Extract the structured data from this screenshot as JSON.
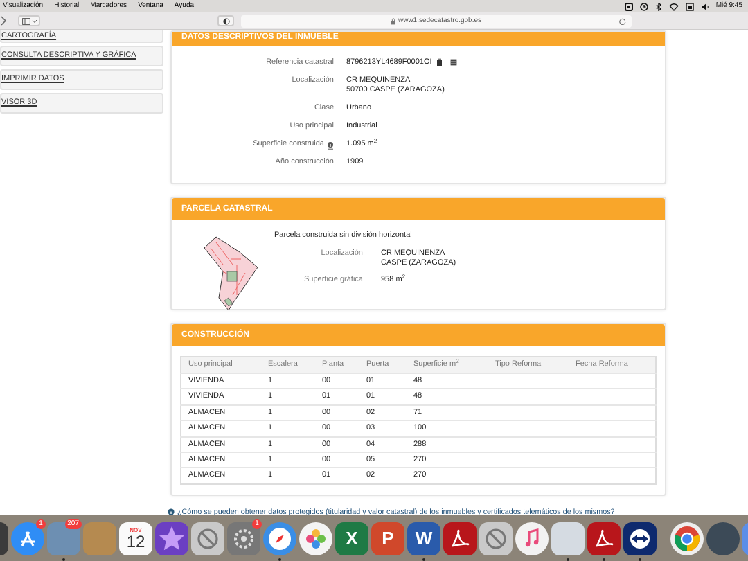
{
  "menu_bar": {
    "items": [
      "Visualización",
      "Historial",
      "Marcadores",
      "Ventana",
      "Ayuda"
    ],
    "clock": "Mié 9:45"
  },
  "toolbar": {
    "url": "www1.sedecatastro.gob.es"
  },
  "sidebar": {
    "items": [
      "CARTOGRAFÍA",
      "CONSULTA DESCRIPTIVA Y GRÁFICA",
      "IMPRIMIR DATOS",
      "VISOR 3D"
    ]
  },
  "sections": [
    {
      "kind": "fields",
      "title": "DATOS DESCRIPTIVOS DEL INMUEBLE",
      "fields": [
        {
          "label": "Referencia catastral",
          "value": [
            "8796213YL4689F0001OI"
          ],
          "tools": true
        },
        {
          "label": "Localización",
          "value": [
            "CR MEQUINENZA",
            "50700 CASPE (ZARAGOZA)"
          ]
        },
        {
          "label": "Clase",
          "value": [
            "Urbano"
          ]
        },
        {
          "label": "Uso principal",
          "value": [
            "Industrial"
          ]
        },
        {
          "label": "Superficie construida",
          "value": [
            "1.095 m$^{2}$"
          ],
          "info": true
        },
        {
          "label": "Año construcción",
          "value": [
            "1909"
          ]
        }
      ]
    },
    {
      "kind": "parcel",
      "title": "PARCELA CATASTRAL",
      "subtitle": "Parcela construida sin división horizontal",
      "fields": [
        {
          "label": "Localización",
          "value": [
            "CR MEQUINENZA",
            "CASPE (ZARAGOZA)"
          ]
        },
        {
          "label": "Superficie gráfica",
          "value": [
            "958 m$^{2}$"
          ]
        }
      ]
    },
    {
      "kind": "table",
      "title": "CONSTRUCCIÓN",
      "columns": [
        "Uso principal",
        "Escalera",
        "Planta",
        "Puerta",
        "Superficie m$^{2}$",
        "Tipo Reforma",
        "Fecha Reforma"
      ],
      "rows": [
        [
          "VIVIENDA",
          "1",
          "00",
          "01",
          "48"
        ],
        [
          "VIVIENDA",
          "1",
          "01",
          "01",
          "48"
        ],
        [
          "ALMACEN",
          "1",
          "00",
          "02",
          "71"
        ],
        [
          "ALMACEN",
          "1",
          "00",
          "03",
          "100"
        ],
        [
          "ALMACEN",
          "1",
          "00",
          "04",
          "288"
        ],
        [
          "ALMACEN",
          "1",
          "00",
          "05",
          "270"
        ],
        [
          "ALMACEN",
          "1",
          "01",
          "02",
          "270"
        ]
      ]
    }
  ],
  "help_link": "¿Cómo se pueden obtener datos protegidos (titularidad y valor catastral) de los inmuebles y certificados telemáticos de los mismos?",
  "dock": [
    {
      "kind": "finder"
    },
    {
      "kind": "appstore",
      "badge": "1"
    },
    {
      "kind": "preview",
      "running": true,
      "badge": "207"
    },
    {
      "kind": "contacts"
    },
    {
      "kind": "calendar",
      "month": "NOV",
      "day": "12"
    },
    {
      "kind": "imovie"
    },
    {
      "kind": "blocked"
    },
    {
      "kind": "settings",
      "badge": "1"
    },
    {
      "kind": "safari",
      "running": true
    },
    {
      "kind": "photos"
    },
    {
      "kind": "excel",
      "glyph": "X"
    },
    {
      "kind": "powerpoint",
      "glyph": "P"
    },
    {
      "kind": "word",
      "running": true,
      "glyph": "W"
    },
    {
      "kind": "acrobat"
    },
    {
      "kind": "blocked"
    },
    {
      "kind": "music"
    },
    {
      "kind": "gallery",
      "running": true
    },
    {
      "kind": "acrobat",
      "running": true
    },
    {
      "kind": "teamviewer",
      "running": true
    },
    {
      "kind": "separator"
    },
    {
      "kind": "chrome"
    },
    {
      "kind": "quicktime"
    },
    {
      "kind": "app"
    }
  ]
}
